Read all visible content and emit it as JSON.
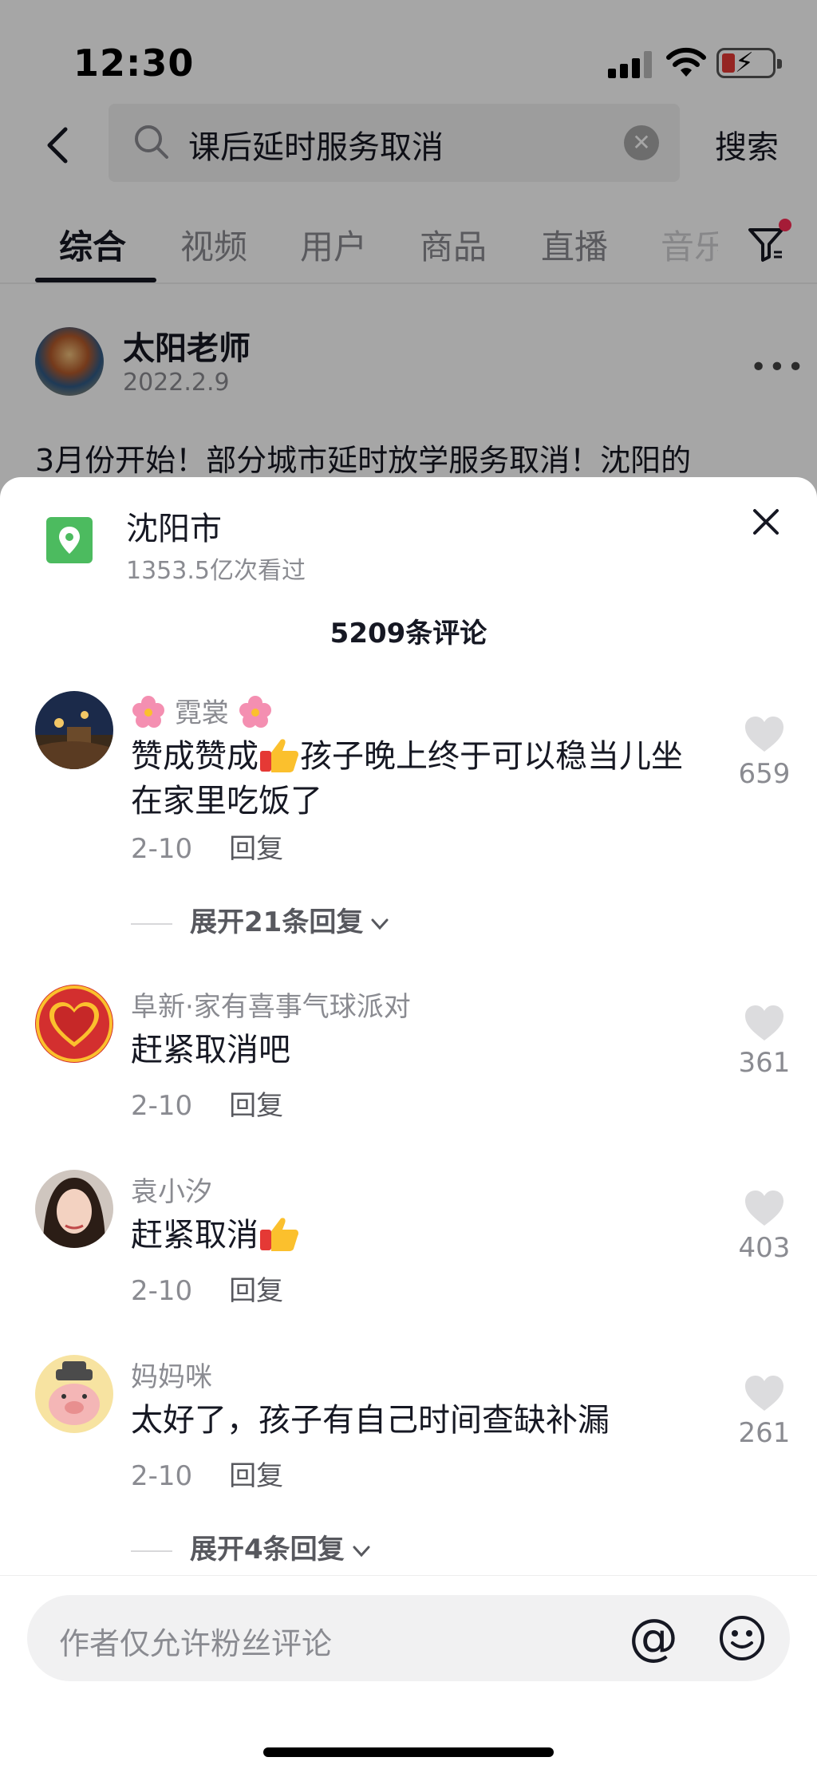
{
  "status_bar": {
    "time": "12:30"
  },
  "search": {
    "query": "课后延时服务取消",
    "button": "搜索"
  },
  "tabs": [
    "综合",
    "视频",
    "用户",
    "商品",
    "直播",
    "音乐"
  ],
  "post": {
    "author": "太阳老师",
    "date": "2022.2.9",
    "text": "3月份开始！部分城市延时放学服务取消！沈阳的",
    "more_icon": "ellipsis-icon"
  },
  "sheet": {
    "location_name": "沈阳市",
    "location_views": "1353.5亿次看过",
    "comment_count": "5209条评论"
  },
  "comments": [
    {
      "name": "霓裳",
      "text_before": "赞成赞成",
      "text_after": "孩子晚上终于可以稳当儿坐在家里吃饭了",
      "date": "2-10",
      "reply": "回复",
      "likes": "659",
      "expand": "展开21条回复"
    },
    {
      "name": "阜新·家有喜事气球派对",
      "text": "赶紧取消吧",
      "date": "2-10",
      "reply": "回复",
      "likes": "361"
    },
    {
      "name": "袁小汐",
      "text": "赶紧取消",
      "date": "2-10",
      "reply": "回复",
      "likes": "403"
    },
    {
      "name": "妈妈咪",
      "text": "太好了，孩子有自己时间查缺补漏",
      "date": "2-10",
      "reply": "回复",
      "likes": "261",
      "expand": "展开4条回复"
    }
  ],
  "input": {
    "placeholder": "作者仅允许粉丝评论",
    "at": "@"
  },
  "colors": {
    "accent": "#fe2c55",
    "location_green": "#4cbb5f",
    "secondary_text": "#8a8b91"
  }
}
